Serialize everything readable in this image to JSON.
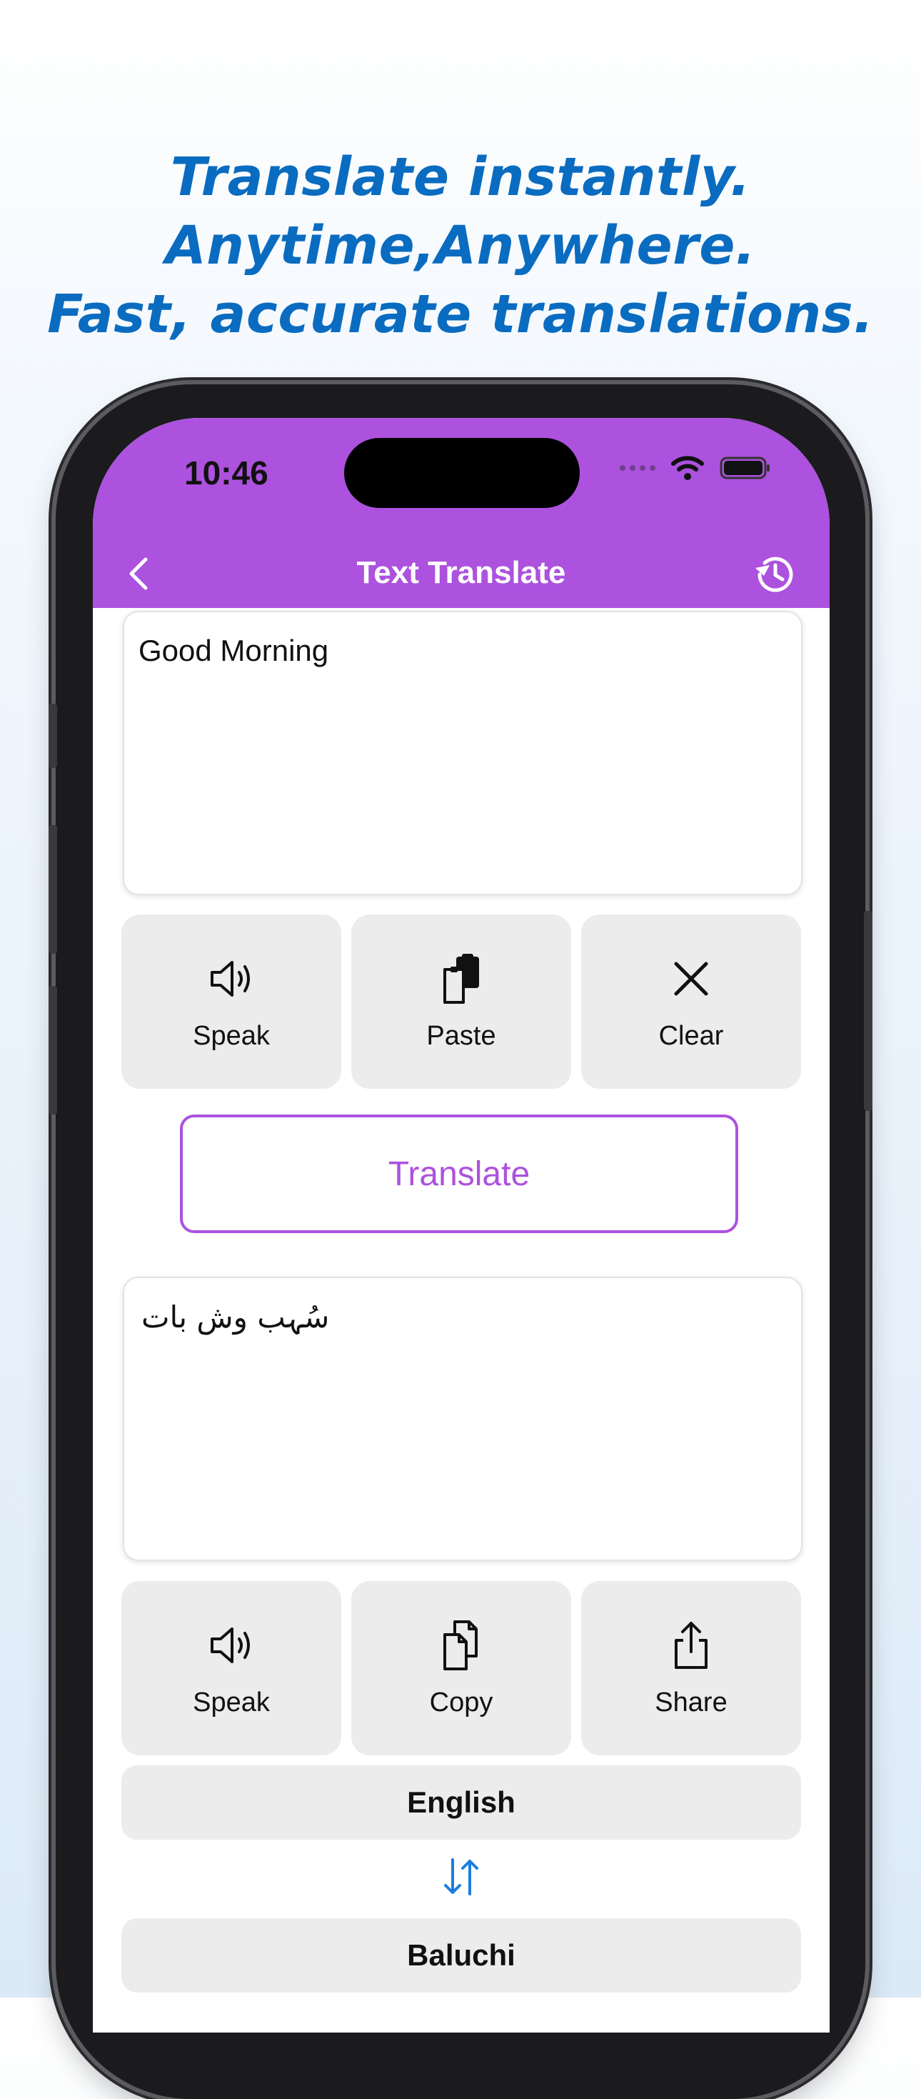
{
  "marketing": {
    "line1": "Translate instantly.",
    "line2": "Anytime,Anywhere.",
    "line3": "Fast, accurate translations."
  },
  "status_bar": {
    "time": "10:46"
  },
  "nav": {
    "title": "Text Translate",
    "back_icon": "chevron-left-icon",
    "history_icon": "history-icon"
  },
  "source": {
    "text": "Good Morning"
  },
  "source_actions": [
    {
      "label": "Speak",
      "icon": "speaker-icon"
    },
    {
      "label": "Paste",
      "icon": "paste-icon"
    },
    {
      "label": "Clear",
      "icon": "close-icon"
    }
  ],
  "translate_button": {
    "label": "Translate"
  },
  "result": {
    "text": "سُہب وش بات"
  },
  "result_actions": [
    {
      "label": "Speak",
      "icon": "speaker-icon"
    },
    {
      "label": "Copy",
      "icon": "copy-icon"
    },
    {
      "label": "Share",
      "icon": "share-icon"
    }
  ],
  "languages": {
    "from": "English",
    "to": "Baluchi",
    "swap_icon": "swap-arrows-icon"
  },
  "colors": {
    "accent": "#ac52de",
    "headline": "#0a6cc0",
    "tile": "#ececec",
    "swap": "#1a7fe0"
  }
}
